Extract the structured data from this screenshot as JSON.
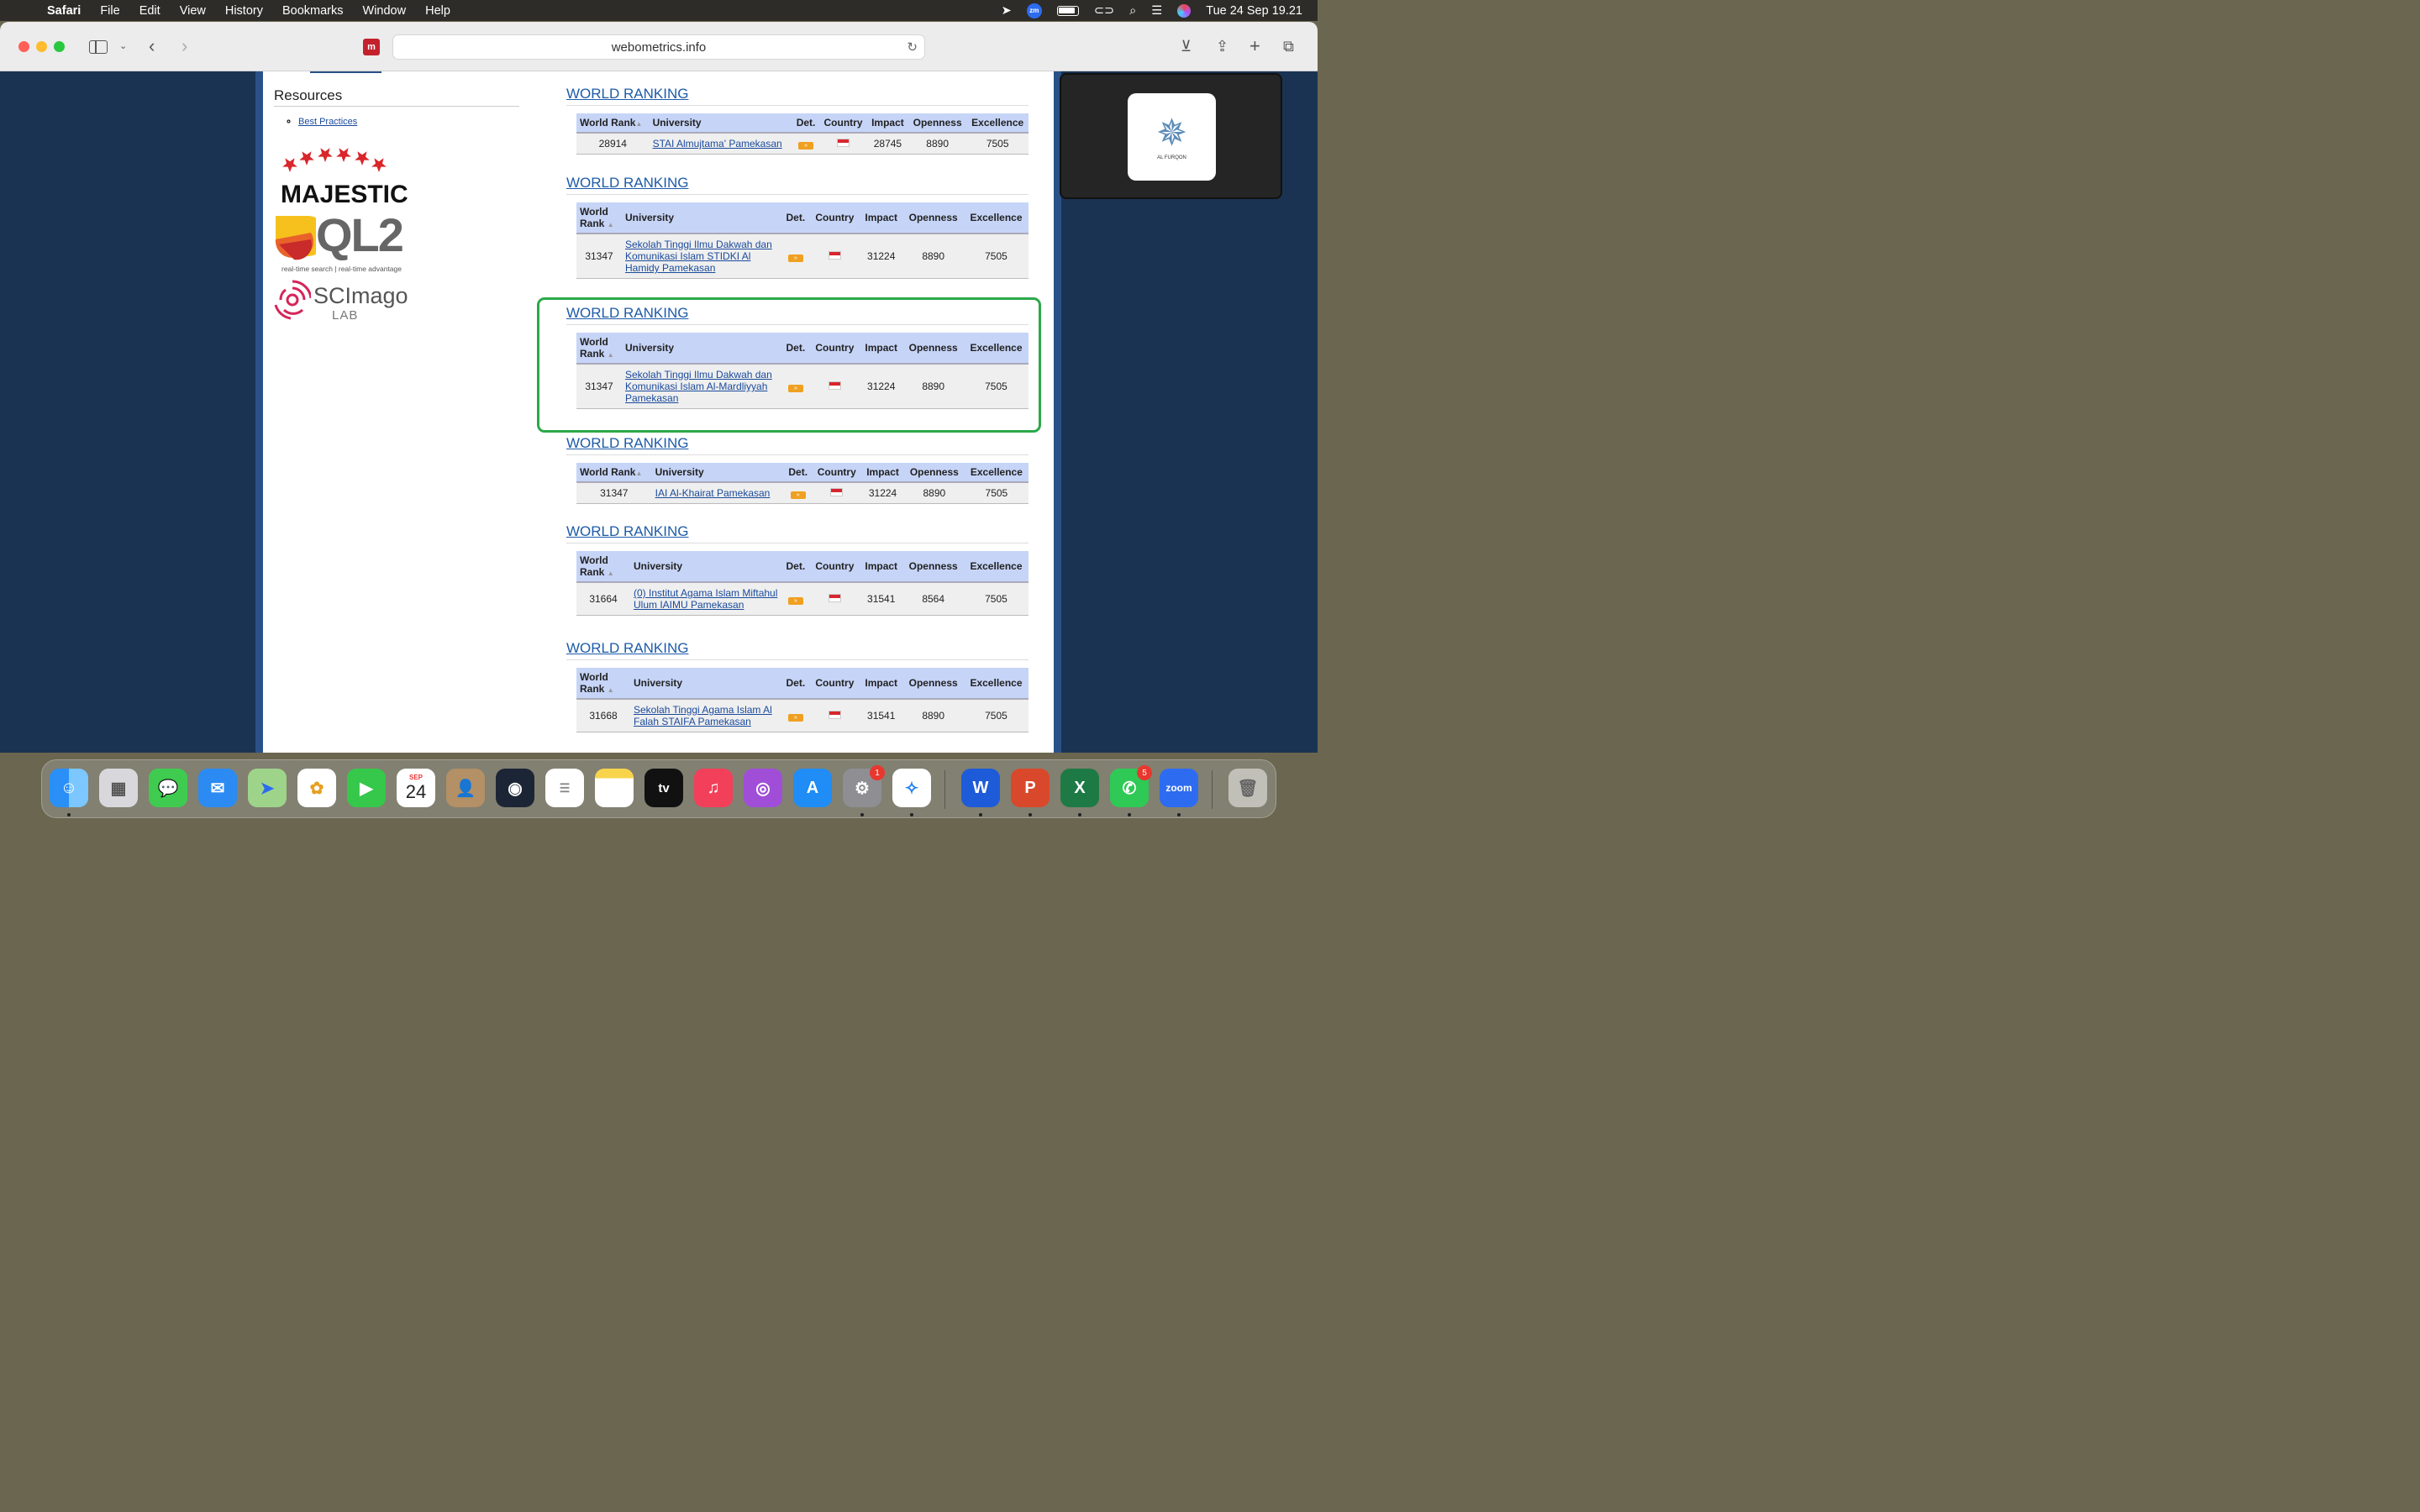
{
  "menubar": {
    "app": "Safari",
    "items": [
      "File",
      "Edit",
      "View",
      "History",
      "Bookmarks",
      "Window",
      "Help"
    ],
    "datetime": "Tue 24 Sep  19.21",
    "zoom_badge": "zm"
  },
  "browser": {
    "url": "webometrics.info"
  },
  "sidebar": {
    "resources_title": "Resources",
    "best_practices": "Best Practices",
    "majestic": "MAJESTIC",
    "ql2": "QL2",
    "ql2_tagline": "real-time search | real-time advantage",
    "scimago": "SCImago",
    "scimago_lab": "LAB"
  },
  "columns": {
    "world_rank": "World Rank",
    "university": "University",
    "det": "Det.",
    "country": "Country",
    "impact": "Impact",
    "openness": "Openness",
    "excellence": "Excellence"
  },
  "rankings": [
    {
      "title": "WORLD RANKING",
      "rank": "28914",
      "university": "STAI Almujtama' Pamekasan",
      "impact": "28745",
      "openness": "8890",
      "excellence": "7505"
    },
    {
      "title": "WORLD RANKING",
      "rank": "31347",
      "university": "Sekolah Tinggi Ilmu Dakwah dan Komunikasi Islam STIDKI Al Hamidy Pamekasan",
      "impact": "31224",
      "openness": "8890",
      "excellence": "7505"
    },
    {
      "title": "WORLD RANKING",
      "rank": "31347",
      "university": "Sekolah Tinggi Ilmu Dakwah dan Komunikasi Islam Al-Mardliyyah Pamekasan",
      "impact": "31224",
      "openness": "8890",
      "excellence": "7505"
    },
    {
      "title": "WORLD RANKING",
      "rank": "31347",
      "university": "IAI Al-Khairat Pamekasan",
      "impact": "31224",
      "openness": "8890",
      "excellence": "7505"
    },
    {
      "title": "WORLD RANKING",
      "rank": "31664",
      "university": "(0) Institut Agama Islam Miftahul Ulum IAIMU Pamekasan",
      "impact": "31541",
      "openness": "8564",
      "excellence": "7505"
    },
    {
      "title": "WORLD RANKING",
      "rank": "31668",
      "university": "Sekolah Tinggi Agama Islam Al Falah STAIFA Pamekasan",
      "impact": "31541",
      "openness": "8890",
      "excellence": "7505"
    }
  ],
  "zoom_window": {
    "name_label": "AL FURQON"
  },
  "dock": {
    "calendar_month": "SEP",
    "calendar_day": "24",
    "appletv": "tv",
    "word": "W",
    "powerpoint": "P",
    "excel": "X",
    "zoom": "zoom",
    "settings_badge": "1",
    "whatsapp_badge": "5"
  }
}
